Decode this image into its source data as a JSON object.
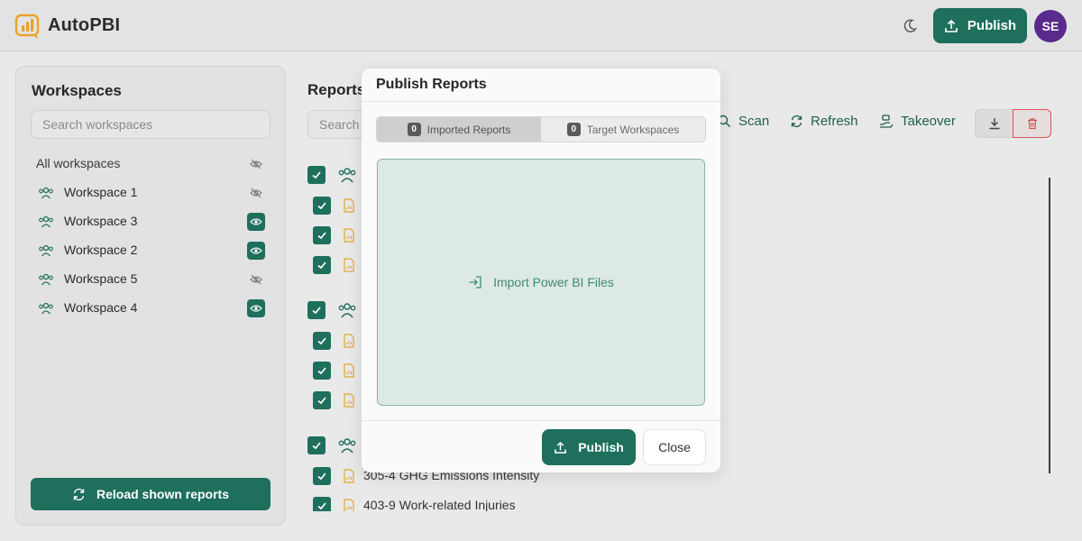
{
  "app": {
    "title": "AutoPBI"
  },
  "header": {
    "publish_label": "Publish",
    "avatar_initials": "SE"
  },
  "sidebar": {
    "title": "Workspaces",
    "search_placeholder": "Search workspaces",
    "items": [
      {
        "label": "All workspaces",
        "visible": false
      },
      {
        "label": "Workspace 1",
        "visible": false
      },
      {
        "label": "Workspace 3",
        "visible": true
      },
      {
        "label": "Workspace 2",
        "visible": true
      },
      {
        "label": "Workspace 5",
        "visible": false
      },
      {
        "label": "Workspace 4",
        "visible": true
      }
    ],
    "reload_label": "Reload shown reports"
  },
  "reports": {
    "title": "Reports",
    "search_placeholder": "Search",
    "toolbar": {
      "scan": "Scan",
      "refresh": "Refresh",
      "takeover": "Takeover"
    },
    "visible_items": [
      "305-4 GHG Emissions Intensity",
      "403-9 Work-related Injuries"
    ]
  },
  "modal": {
    "title": "Publish Reports",
    "tabs": [
      {
        "label": "Imported Reports",
        "count": "0",
        "active": true
      },
      {
        "label": "Target Workspaces",
        "count": "0",
        "active": false
      }
    ],
    "dropzone_label": "Import Power BI Files",
    "publish_label": "Publish",
    "close_label": "Close"
  },
  "colors": {
    "accent": "#1e6f5c",
    "avatar": "#5a2a8c",
    "doc_icon": "#e2a632",
    "danger": "#d9534f"
  }
}
